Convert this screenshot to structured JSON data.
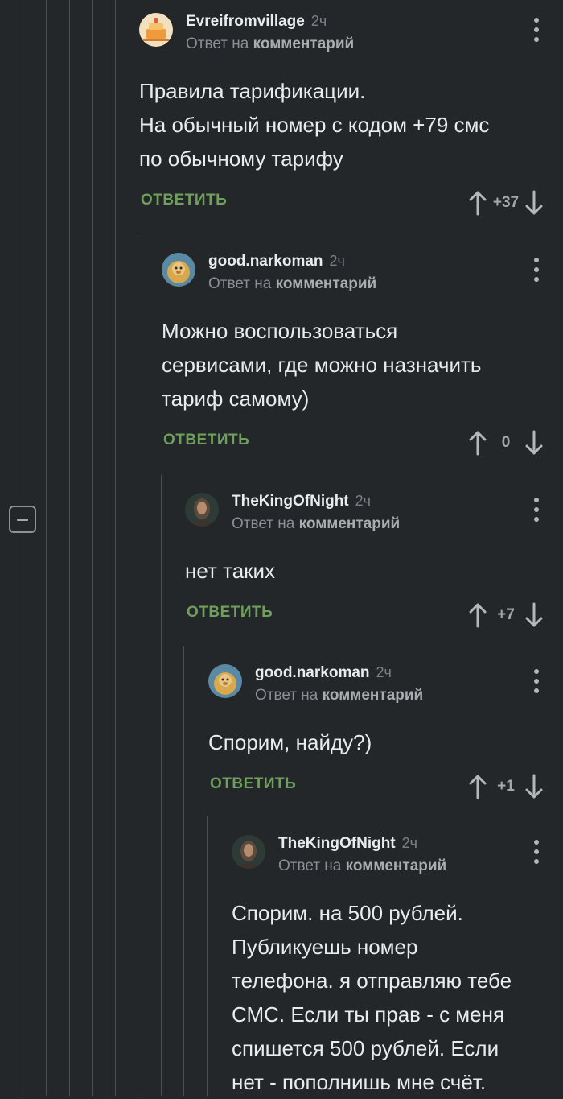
{
  "ui": {
    "reply_label": "ОТВЕТИТЬ",
    "reply_to_prefix": "Ответ на",
    "reply_to_link": "комментарий"
  },
  "comments": [
    {
      "author": "Evreifromvillage",
      "time": "2ч",
      "avatar_icon": "cake-avatar-icon",
      "lines": [
        "Правила тарификации.",
        "На обычный номер с кодом +79 смс",
        "по обычному тарифу"
      ],
      "score": "+37"
    },
    {
      "author": "good.narkoman",
      "time": "2ч",
      "avatar_icon": "monkey-avatar-icon",
      "lines": [
        "Можно воспользоваться",
        "сервисами, где можно назначить",
        "тариф самому)"
      ],
      "score": "0"
    },
    {
      "author": "TheKingOfNight",
      "time": "2ч",
      "avatar_icon": "person-avatar-icon",
      "lines": [
        "нет таких"
      ],
      "score": "+7"
    },
    {
      "author": "good.narkoman",
      "time": "2ч",
      "avatar_icon": "monkey-avatar-icon",
      "lines": [
        "Спорим, найду?)"
      ],
      "score": "+1"
    },
    {
      "author": "TheKingOfNight",
      "time": "2ч",
      "avatar_icon": "person-avatar-icon",
      "lines": [
        "Спорим. на 500 рублей.",
        "Публикуешь номер",
        "телефона. я отправляю тебе",
        "СМС. Если ты прав - с меня",
        "спишется 500 рублей. Если",
        "нет - пополнишь мне счёт."
      ]
    }
  ],
  "colors": {
    "background": "#23272a",
    "reply_green": "#6f9f5c",
    "thread_line": "#4a4f53"
  }
}
